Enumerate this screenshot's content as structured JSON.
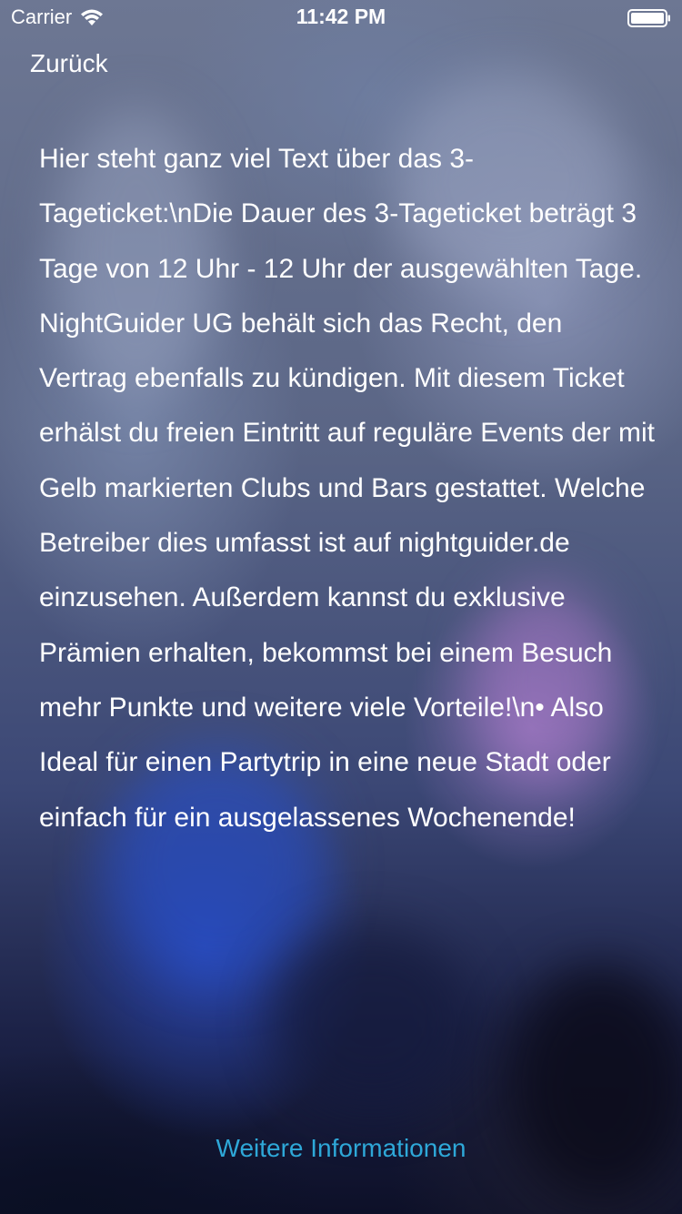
{
  "status_bar": {
    "carrier": "Carrier",
    "time": "11:42 PM"
  },
  "nav": {
    "back_label": "Zurück"
  },
  "content": {
    "description": "Hier steht ganz viel Text über das 3-Tageticket:\\nDie Dauer des 3-Tageticket beträgt 3 Tage von 12 Uhr - 12 Uhr der ausgewählten Tage.  NightGuider UG behält sich das Recht, den Vertrag ebenfalls zu kündigen. Mit diesem Ticket erhälst du freien Eintritt auf reguläre Events der mit Gelb markierten Clubs und Bars gestattet. Welche Betreiber dies umfasst ist auf nightguider.de einzusehen. Außerdem kannst du exklusive Prämien erhalten, bekommst bei einem Besuch mehr Punkte und weitere viele Vorteile!\\n• Also Ideal für einen Partytrip in eine neue Stadt oder einfach für ein ausgelassenes Wochenende!"
  },
  "footer": {
    "more_info_label": "Weitere Informationen"
  },
  "colors": {
    "text": "#ffffff",
    "link": "#2ea8d8"
  }
}
